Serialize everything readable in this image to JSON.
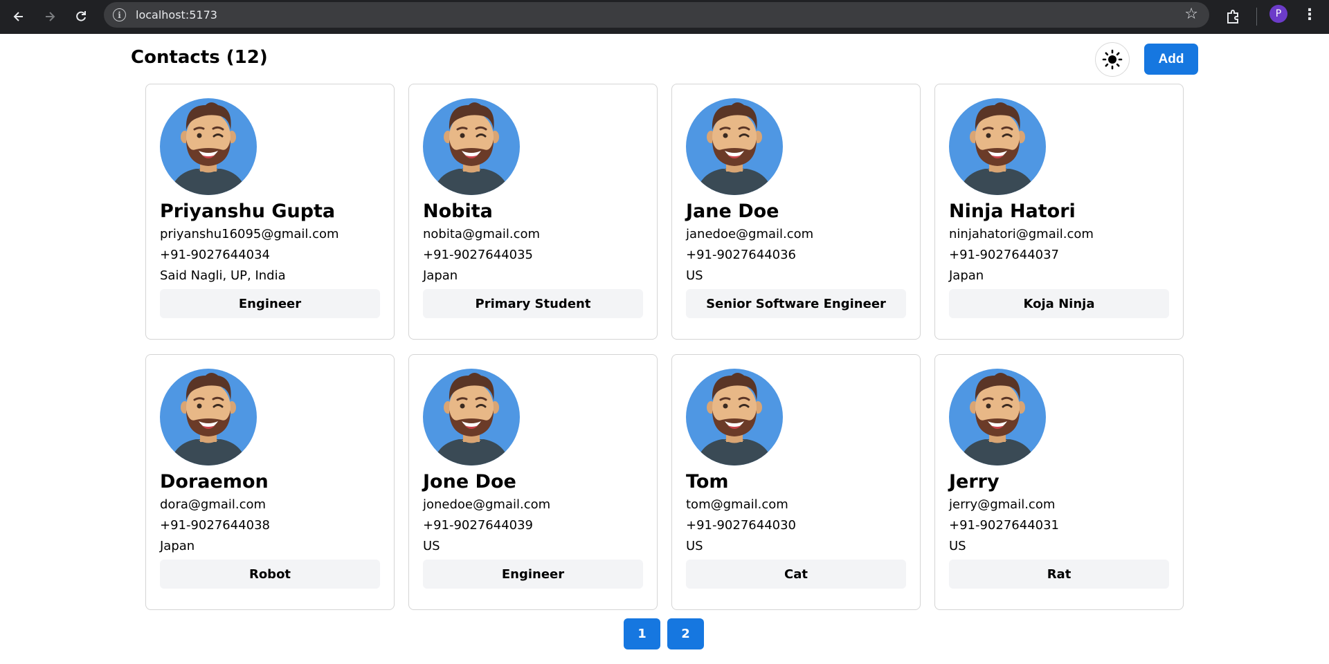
{
  "browser": {
    "url": "localhost:5173",
    "profile_initial": "P"
  },
  "header": {
    "title": "Contacts (12)",
    "add_label": "Add",
    "theme_icon": "sun-icon"
  },
  "contacts": [
    {
      "name": "Priyanshu Gupta",
      "email": "priyanshu16095@gmail.com",
      "phone": "+91-9027644034",
      "address": "Said Nagli, UP, India",
      "role": "Engineer"
    },
    {
      "name": "Nobita",
      "email": "nobita@gmail.com",
      "phone": "+91-9027644035",
      "address": "Japan",
      "role": "Primary Student"
    },
    {
      "name": "Jane Doe",
      "email": "janedoe@gmail.com",
      "phone": "+91-9027644036",
      "address": "US",
      "role": "Senior Software Engineer"
    },
    {
      "name": "Ninja Hatori",
      "email": "ninjahatori@gmail.com",
      "phone": "+91-9027644037",
      "address": "Japan",
      "role": "Koja Ninja"
    },
    {
      "name": "Doraemon",
      "email": "dora@gmail.com",
      "phone": "+91-9027644038",
      "address": "Japan",
      "role": "Robot"
    },
    {
      "name": "Jone Doe",
      "email": "jonedoe@gmail.com",
      "phone": "+91-9027644039",
      "address": "US",
      "role": "Engineer"
    },
    {
      "name": "Tom",
      "email": "tom@gmail.com",
      "phone": "+91-9027644030",
      "address": "US",
      "role": "Cat"
    },
    {
      "name": "Jerry",
      "email": "jerry@gmail.com",
      "phone": "+91-9027644031",
      "address": "US",
      "role": "Rat"
    }
  ],
  "pagination": {
    "pages": [
      "1",
      "2"
    ]
  },
  "colors": {
    "accent": "#1677e0",
    "avatar_bg": "#4f97e3",
    "chrome_bg": "#202124"
  }
}
